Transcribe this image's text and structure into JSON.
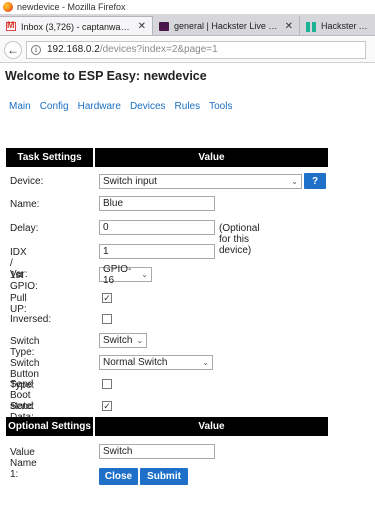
{
  "window": {
    "title": "newdevice - Mozilla Firefox"
  },
  "tabs": [
    {
      "label": "Inbox (3,726) - captanwaar...",
      "icon": "gmail-icon",
      "close": "✕"
    },
    {
      "label": "general | Hackster Live Slack",
      "icon": "slack-icon",
      "close": "✕"
    },
    {
      "label": "Hackster Ambas",
      "icon": "hackster-icon",
      "close": ""
    }
  ],
  "address": {
    "host": "192.168.0.2",
    "path": "/devices?index=2&page=1"
  },
  "page": {
    "title": "Welcome to ESP Easy: newdevice",
    "menu": [
      "Main",
      "Config",
      "Hardware",
      "Devices",
      "Rules",
      "Tools"
    ]
  },
  "form": {
    "header_left": "Task Settings",
    "header_right": "Value",
    "device_label": "Device:",
    "device_value": "Switch input",
    "help_label": "?",
    "name_label": "Name:",
    "name_value": "Blue",
    "delay_label": "Delay:",
    "delay_value": "0",
    "delay_note": "(Optional for this device)",
    "idx_label": "IDX / Var:",
    "idx_value": "1",
    "gpio_label": "1st GPIO:",
    "gpio_value": "GPIO-16",
    "pullup_label": "Pull UP:",
    "pullup_checked": true,
    "inversed_label": "Inversed:",
    "inversed_checked": false,
    "switch_type_label": "Switch Type:",
    "switch_type_value": "Switch",
    "switch_button_type_label": "Switch Button Type:",
    "switch_button_type_value": "Normal Switch",
    "send_boot_label": "Send Boot state:",
    "send_boot_checked": false,
    "send_data_label": "Send Data:",
    "send_data_checked": true,
    "optional_header_left": "Optional Settings",
    "optional_header_right": "Value",
    "value_name_label": "Value Name 1:",
    "value_name_value": "Switch",
    "close_label": "Close",
    "submit_label": "Submit"
  },
  "colors": {
    "accent": "#1f70c9",
    "link": "#1b6fc2",
    "header_bg": "#000000"
  }
}
